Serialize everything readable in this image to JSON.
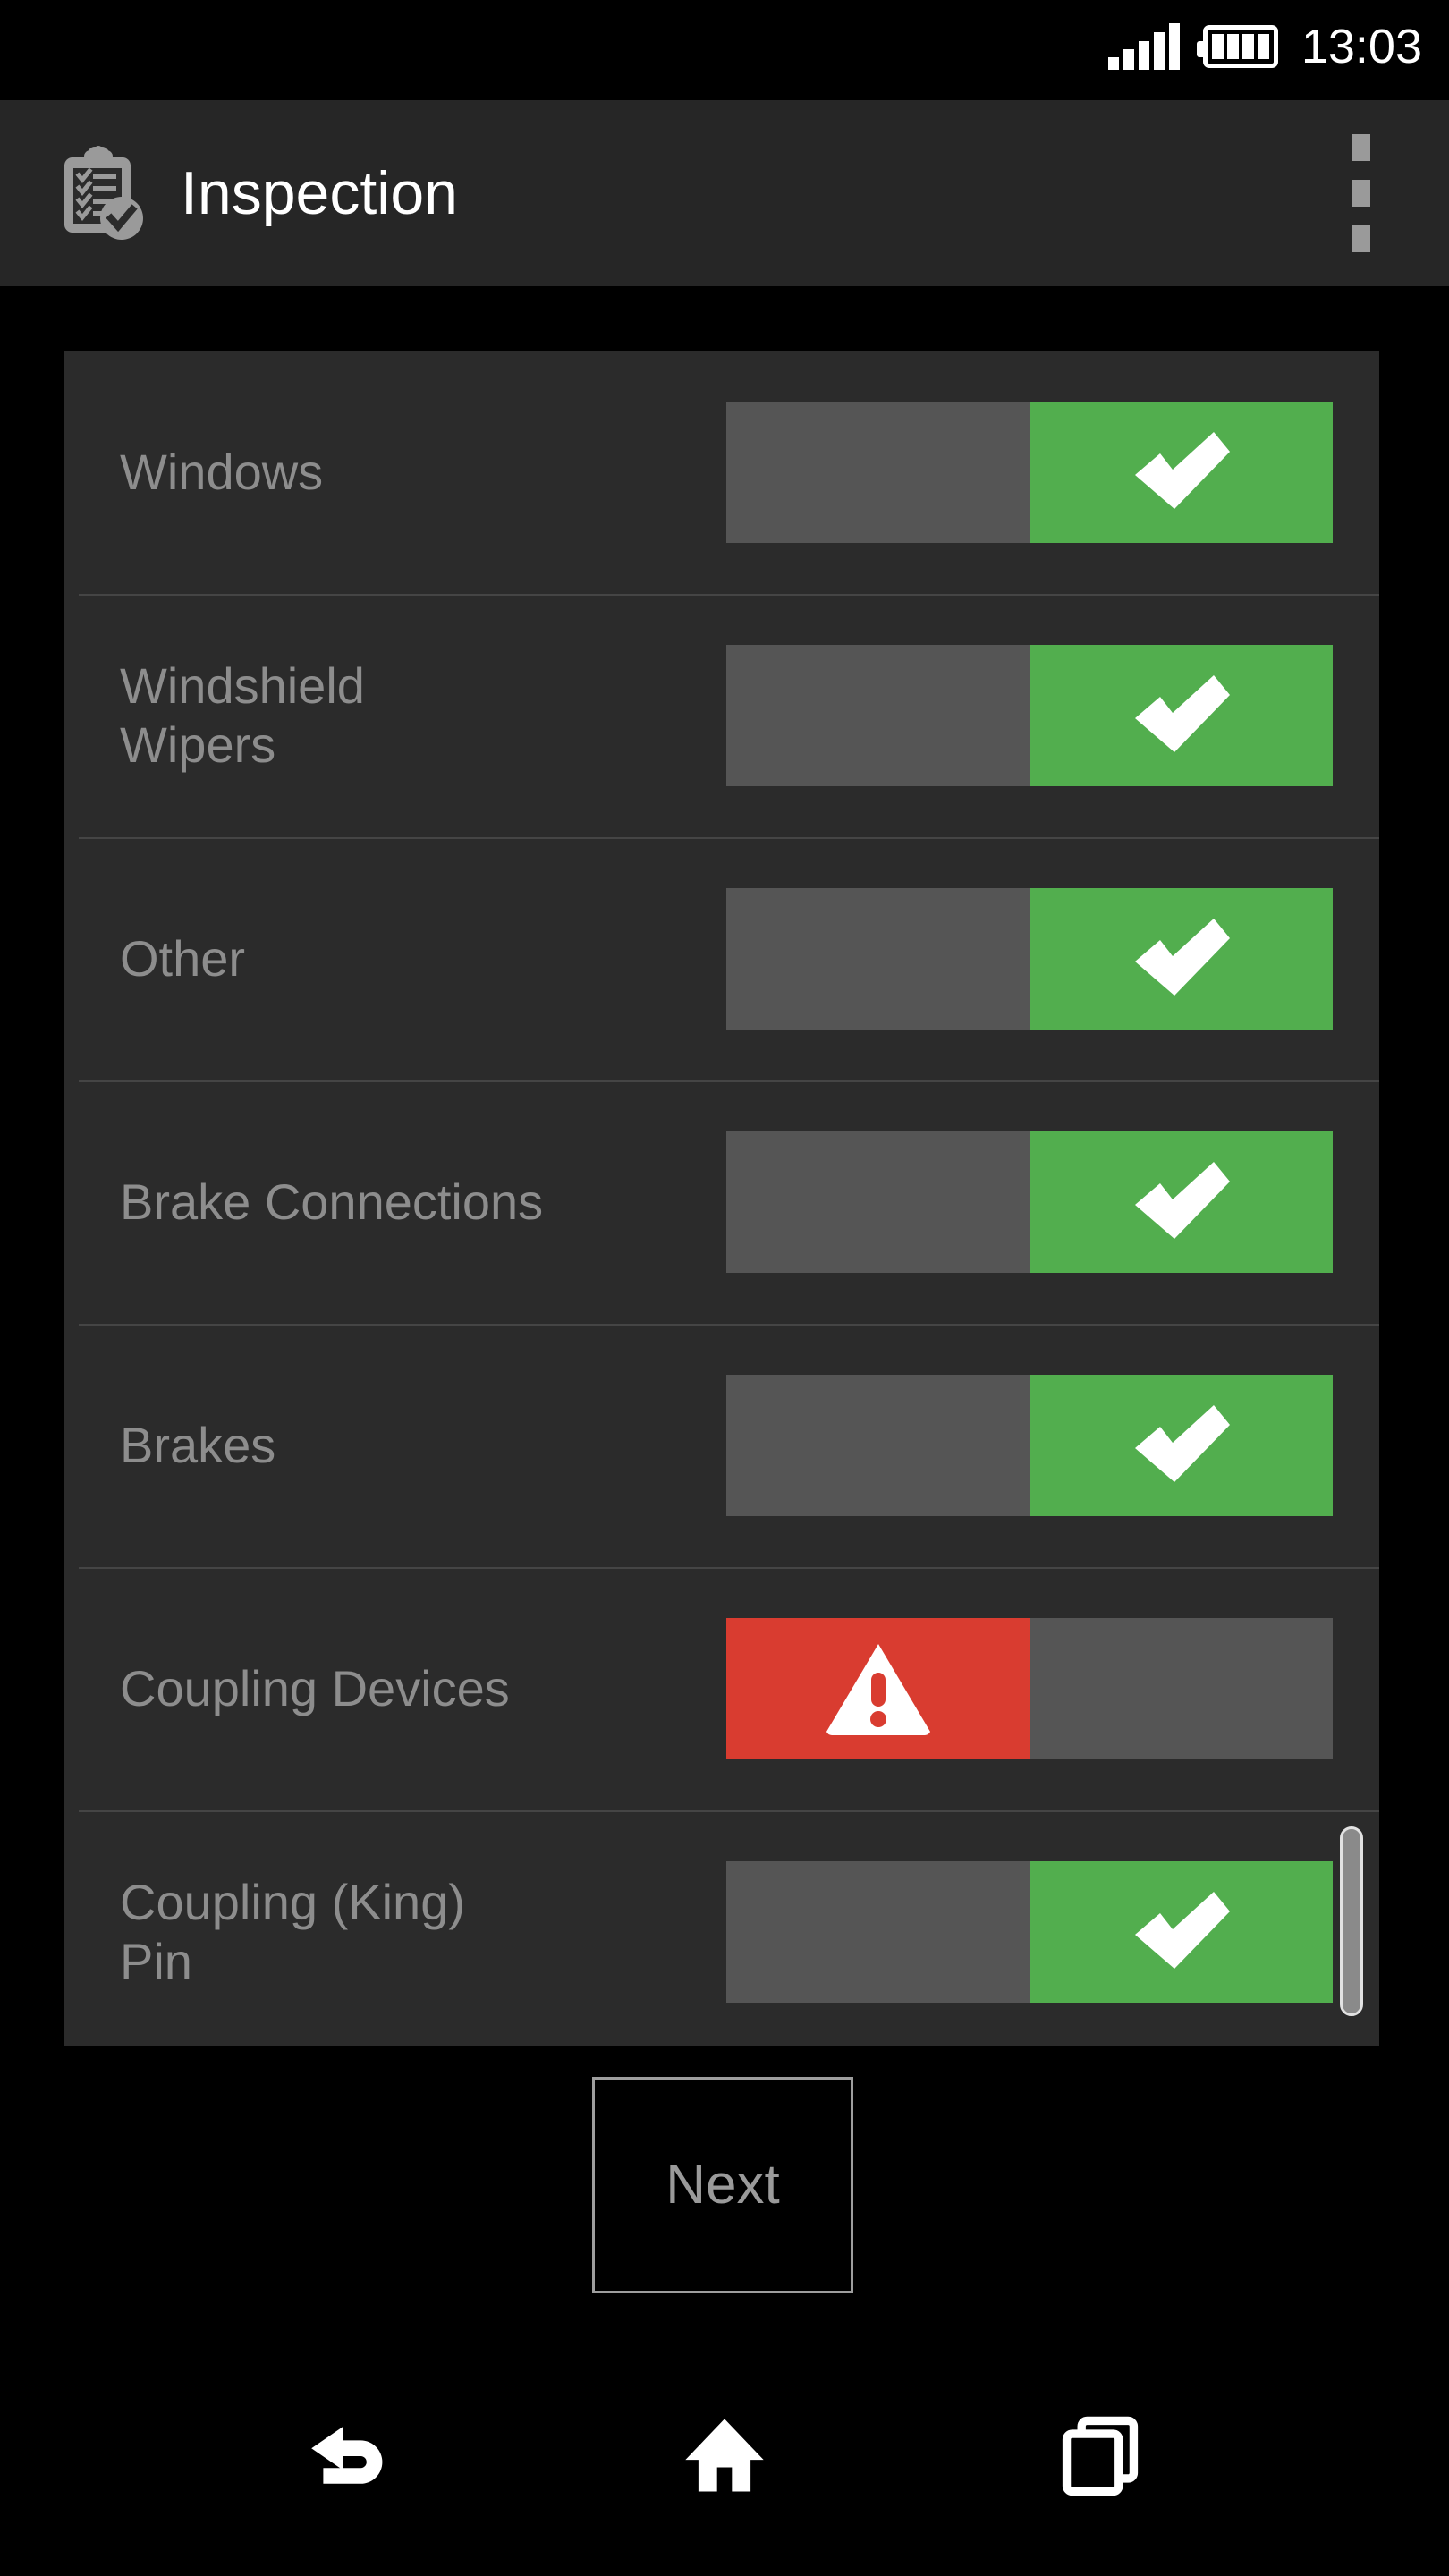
{
  "status_bar": {
    "signal_icon": "signal-bars-icon",
    "signal_bars_total": 5,
    "signal_bars_filled": 5,
    "battery_icon": "battery-full-icon",
    "battery_segments": 4,
    "time": "13:03"
  },
  "app_bar": {
    "app_icon": "clipboard-checklist-icon",
    "title": "Inspection",
    "overflow_icon": "overflow-menu-icon"
  },
  "colors": {
    "page_background": "#000000",
    "app_bar_background": "#262626",
    "list_background": "#2b2b2b",
    "divider": "#454545",
    "label_text": "#8d8d8d",
    "segment_inactive": "#555555",
    "status_ok": "#52ae4e",
    "status_defect": "#d93c30",
    "scrollbar_thumb": "#8a8a8a"
  },
  "inspection_list": {
    "items": [
      {
        "label": "Windows",
        "state": "ok",
        "ok_icon": "check-icon",
        "defect_icon": "warning-triangle-icon"
      },
      {
        "label": "Windshield\nWipers",
        "state": "ok",
        "ok_icon": "check-icon",
        "defect_icon": "warning-triangle-icon"
      },
      {
        "label": "Other",
        "state": "ok",
        "ok_icon": "check-icon",
        "defect_icon": "warning-triangle-icon"
      },
      {
        "label": "Brake Connections",
        "state": "ok",
        "ok_icon": "check-icon",
        "defect_icon": "warning-triangle-icon"
      },
      {
        "label": "Brakes",
        "state": "ok",
        "ok_icon": "check-icon",
        "defect_icon": "warning-triangle-icon"
      },
      {
        "label": "Coupling Devices",
        "state": "defect",
        "ok_icon": "check-icon",
        "defect_icon": "warning-triangle-icon"
      },
      {
        "label": "Coupling (King)\nPin",
        "state": "ok",
        "ok_icon": "check-icon",
        "defect_icon": "warning-triangle-icon"
      }
    ]
  },
  "scrollbar": {
    "icon": "scrollbar-thumb"
  },
  "footer": {
    "next_label": "Next"
  },
  "nav_bar": {
    "back_icon": "back-arrow-icon",
    "home_icon": "home-icon",
    "recents_icon": "recent-apps-icon"
  }
}
